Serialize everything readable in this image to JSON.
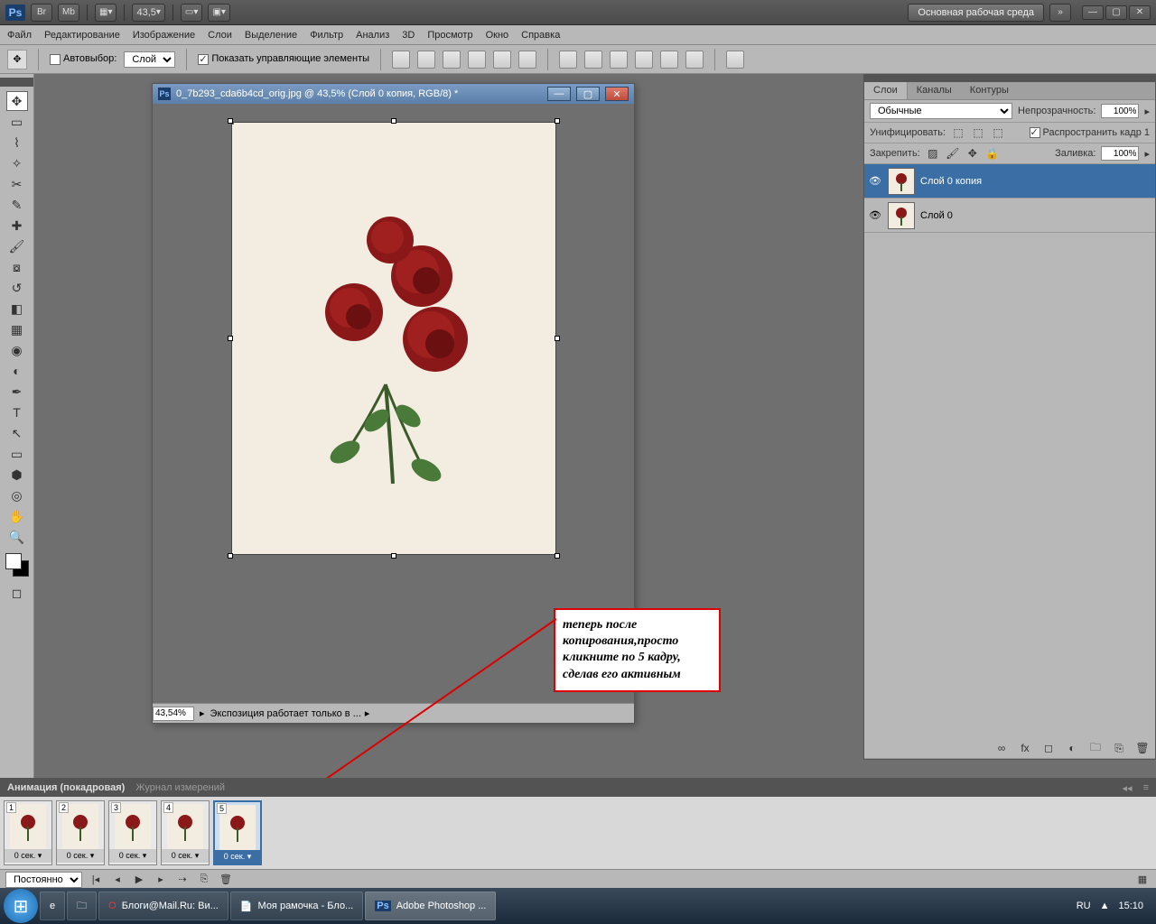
{
  "topbar": {
    "zoom": "43,5",
    "workspace": "Основная рабочая среда"
  },
  "menu": [
    "Файл",
    "Редактирование",
    "Изображение",
    "Слои",
    "Выделение",
    "Фильтр",
    "Анализ",
    "3D",
    "Просмотр",
    "Окно",
    "Справка"
  ],
  "optbar": {
    "autoselect": "Автовыбор:",
    "autoselect_val": "Слой",
    "show_controls": "Показать управляющие элементы"
  },
  "doc": {
    "title": "0_7b293_cda6b4cd_orig.jpg @ 43,5% (Слой 0 копия, RGB/8) *",
    "zoom": "43,54%",
    "status": "Экспозиция работает только в ..."
  },
  "callout": "теперь  после копирования,просто кликните по 5 кадру, сделав его активным",
  "layers": {
    "tabs": [
      "Слои",
      "Каналы",
      "Контуры"
    ],
    "blend": "Обычные",
    "opacity_label": "Непрозрачность:",
    "opacity": "100%",
    "unify": "Унифицировать:",
    "propagate": "Распространить кадр 1",
    "lock": "Закрепить:",
    "fill_label": "Заливка:",
    "fill": "100%",
    "items": [
      {
        "name": "Слой 0 копия",
        "sel": true
      },
      {
        "name": "Слой 0",
        "sel": false
      }
    ]
  },
  "anim": {
    "tabs": [
      "Анимация (покадровая)",
      "Журнал измерений"
    ],
    "frames": [
      {
        "n": "1",
        "d": "0 сек."
      },
      {
        "n": "2",
        "d": "0 сек."
      },
      {
        "n": "3",
        "d": "0 сек."
      },
      {
        "n": "4",
        "d": "0 сек."
      },
      {
        "n": "5",
        "d": "0 сек."
      }
    ],
    "loop": "Постоянно"
  },
  "taskbar": {
    "items": [
      "Блоги@Mail.Ru: Ви...",
      "Моя рамочка - Бло...",
      "Adobe Photoshop ..."
    ],
    "lang": "RU",
    "time": "15:10"
  }
}
